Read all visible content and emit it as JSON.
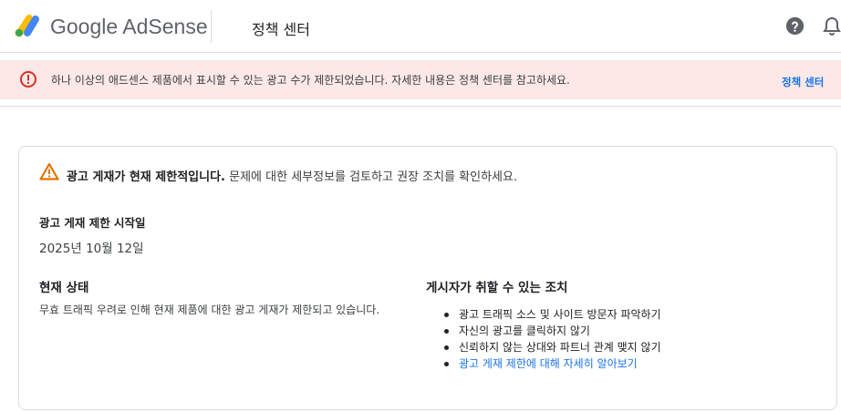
{
  "header": {
    "logo_text": "Google AdSense",
    "title": "정책 센터",
    "icons": {
      "logo": "adsense-logo-icon",
      "help": "help-icon",
      "notifications": "bell-icon"
    }
  },
  "banner": {
    "icon": "error-icon",
    "message": "하나 이상의 애드센스 제품에서 표시할 수 있는 광고 수가 제한되었습니다. 자세한 내용은 정책 센터를 참고하세요.",
    "link_label": "정책 센터",
    "background_color": "#fce8e6",
    "icon_color": "#d93025"
  },
  "card": {
    "warning_icon": "warning-triangle-icon",
    "headline_bold": "광고 게재가 현재 제한적입니다.",
    "headline_rest": " 문제에 대한 세부정보를 검토하고 권장 조치를 확인하세요.",
    "start_label": "광고 게재 제한 시작일",
    "start_value": "2025년 10월 12일",
    "status_title": "현재 상태",
    "status_description": "무효 트래픽 우려로 인해 현재 제품에 대한 광고 게재가 제한되고 있습니다.",
    "actions_title": "게시자가 취할 수 있는 조치",
    "actions": [
      "광고 트래픽 소스 및 사이트 방문자 파악하기",
      "자신의 광고를 클릭하지 않기",
      "신뢰하지 않는 상대와 파트너 관계 맺지 않기"
    ],
    "learn_more_link": "광고 게재 제한에 대해 자세히 알아보기",
    "warning_color": "#e37400",
    "link_color": "#1a73e8"
  }
}
